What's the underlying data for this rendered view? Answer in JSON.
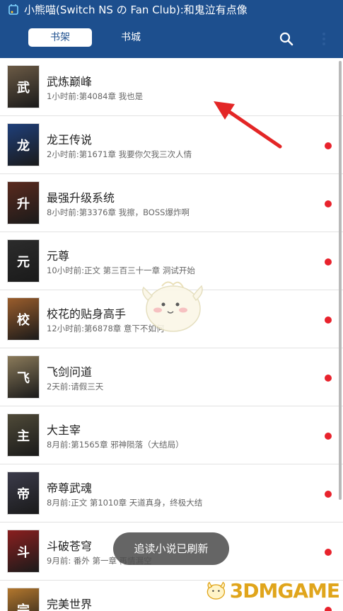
{
  "status_bar": {
    "notification_text": "小熊喵(Switch NS の Fan Club):和鬼泣有点像"
  },
  "tabs": [
    {
      "label": "书架",
      "active": true
    },
    {
      "label": "书城",
      "active": false
    }
  ],
  "icons": {
    "search": "search-icon",
    "more": "more-vert-icon"
  },
  "colors": {
    "header": "#1d4f8e",
    "unread_dot": "#e8222c"
  },
  "books": [
    {
      "title": "武炼巅峰",
      "subtitle": "1小时前:第4084章 我也是",
      "unread": false,
      "cover_color": "#6b5a45",
      "cover_glyph": "武"
    },
    {
      "title": "龙王传说",
      "subtitle": "2小时前:第1671章 我要你欠我三次人情",
      "unread": true,
      "cover_color": "#1f3f7a",
      "cover_glyph": "龙"
    },
    {
      "title": "最强升级系统",
      "subtitle": "8小时前:第3376章 我擦，BOSS爆炸啊",
      "unread": true,
      "cover_color": "#5a2a1e",
      "cover_glyph": "升"
    },
    {
      "title": "元尊",
      "subtitle": "10小时前:正文 第三百三十一章 洞试开始",
      "unread": true,
      "cover_color": "#2c2c2c",
      "cover_glyph": "元"
    },
    {
      "title": "校花的贴身高手",
      "subtitle": "12小时前:第6878章 意下不如何",
      "unread": true,
      "cover_color": "#9a5d2c",
      "cover_glyph": "校"
    },
    {
      "title": "飞剑问道",
      "subtitle": "2天前:请假三天",
      "unread": true,
      "cover_color": "#8a7a5a",
      "cover_glyph": "飞"
    },
    {
      "title": "大主宰",
      "subtitle": "8月前:第1565章 邪神陨落（大结局）",
      "unread": true,
      "cover_color": "#4f4a38",
      "cover_glyph": "主"
    },
    {
      "title": "帝尊武魂",
      "subtitle": "8月前:正文 第1010章 天道真身，终极大结",
      "unread": true,
      "cover_color": "#3b3b4a",
      "cover_glyph": "帝"
    },
    {
      "title": "斗破苍穹",
      "subtitle": "9月前: 番外 第一章 再情漏空",
      "unread": true,
      "cover_color": "#8a1f1f",
      "cover_glyph": "斗"
    },
    {
      "title": "完美世界",
      "subtitle": "",
      "unread": true,
      "cover_color": "#b3772d",
      "cover_glyph": "完"
    }
  ],
  "toast": {
    "text": "追读小说已刷新"
  },
  "watermark": {
    "text": "3DMGAME"
  }
}
